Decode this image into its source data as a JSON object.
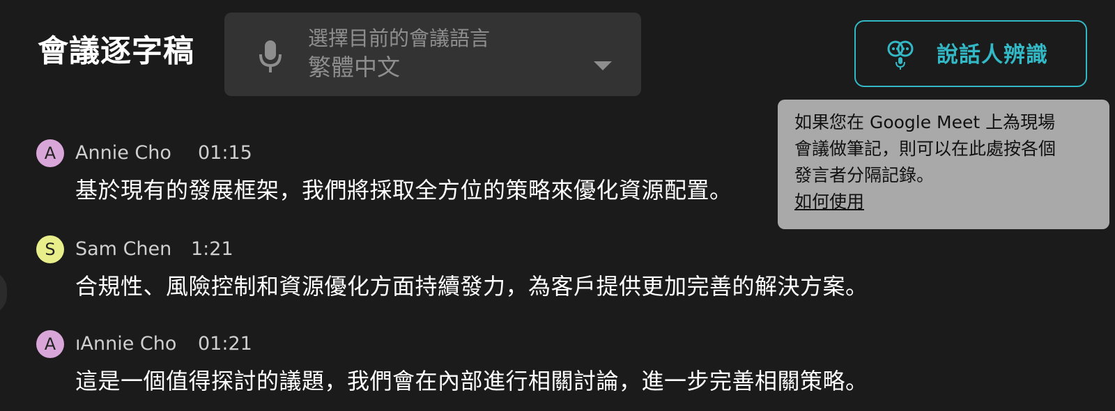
{
  "header": {
    "title": "會議逐字稿",
    "language": {
      "icon": "microphone-icon",
      "label": "選擇目前的會議語言",
      "value": "繁體中文"
    },
    "speaker_button": {
      "icon": "speaker-identification-icon",
      "label": "說話人辨識"
    }
  },
  "tooltip": {
    "lines": [
      "如果您在 Google Meet 上為現場",
      "會議做筆記，則可以在此處按各個",
      "發言者分隔記錄。"
    ],
    "link": "如何使用"
  },
  "transcript": [
    {
      "avatar_letter": "A",
      "avatar_color": "#d9a6d9",
      "name": "Annie Cho",
      "time": "01:15",
      "text": "基於現有的發展框架，我們將採取全方位的策略來優化資源配置。"
    },
    {
      "avatar_letter": "S",
      "avatar_color": "#e8ef8a",
      "name": "Sam Chen",
      "time": "1:21",
      "text": "合規性、風險控制和資源優化方面持續發力，為客戶提供更加完善的解決方案。"
    },
    {
      "avatar_letter": "A",
      "avatar_color": "#d9a6d9",
      "name": "ıAnnie Cho",
      "time": "01:21",
      "text": "這是一個值得探討的議題，我們會在內部進行相關討論，進一步完善相關策略。"
    }
  ],
  "colors": {
    "background": "#1b1b1b",
    "accent": "#33b8c6",
    "tooltip_bg": "#a9a9a9"
  }
}
